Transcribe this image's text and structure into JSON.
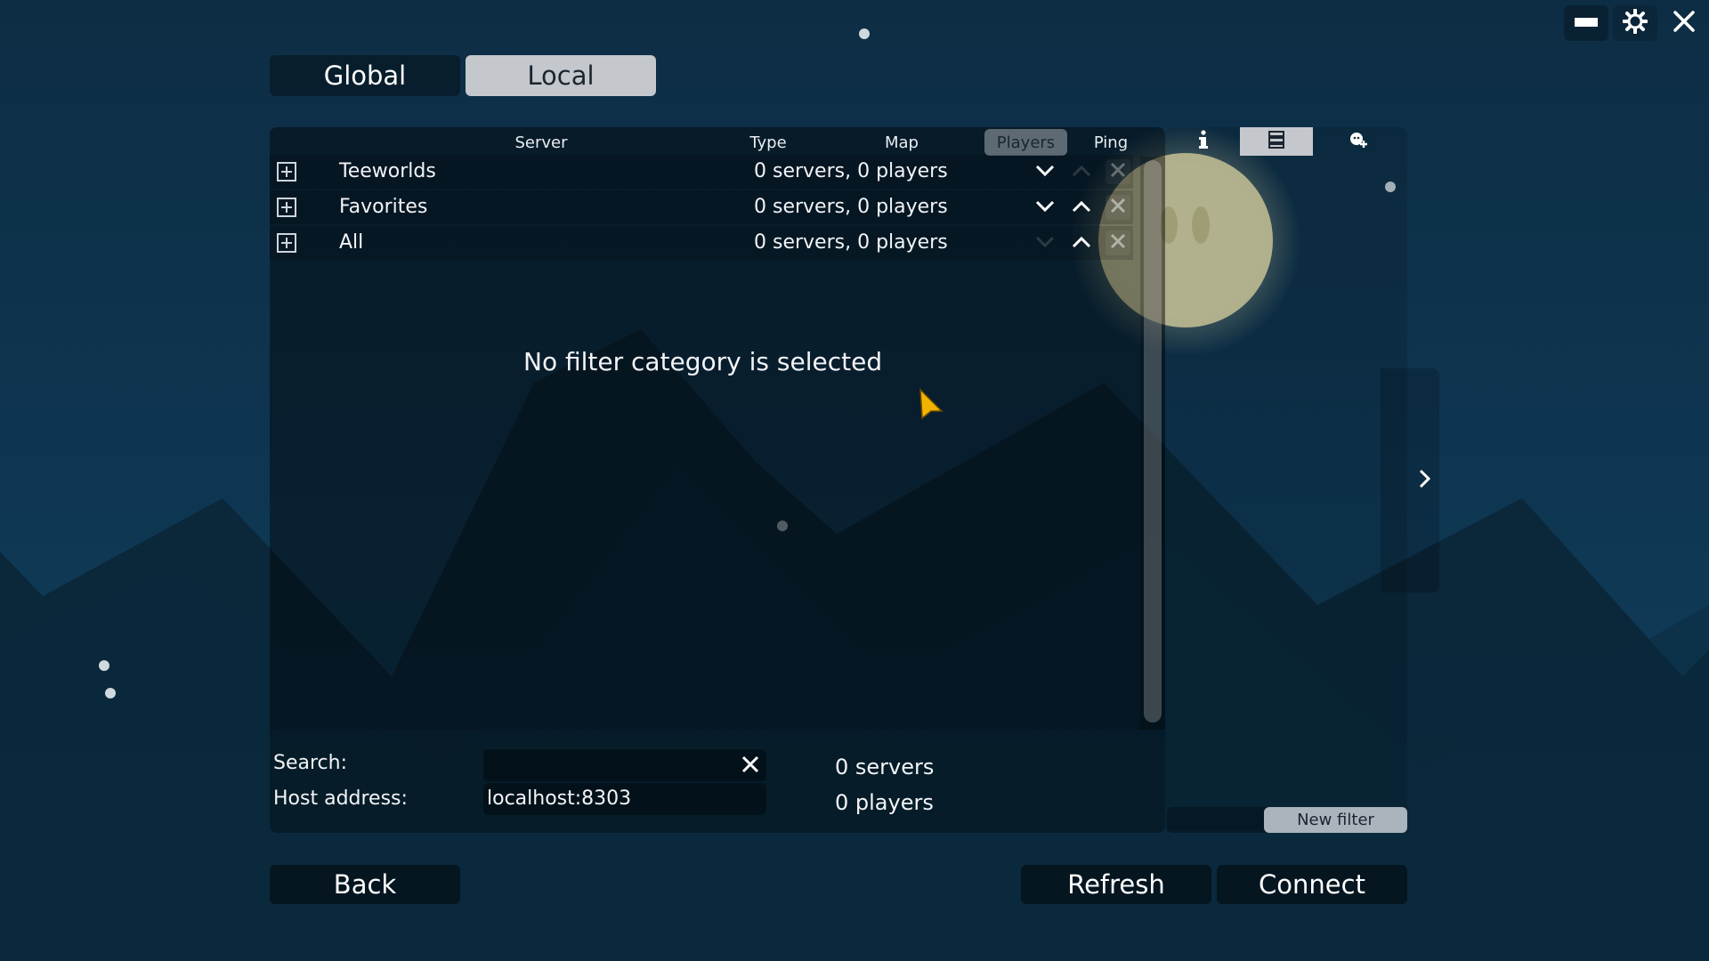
{
  "window_controls": {
    "minimize_icon": "minimize-icon",
    "settings_icon": "gear-icon",
    "close_icon": "close-icon"
  },
  "tabs": {
    "global": "Global",
    "local": "Local",
    "active": "Local"
  },
  "columns": [
    "Server",
    "Type",
    "Map",
    "Players",
    "Ping"
  ],
  "active_sort_column": "Players",
  "filters": [
    {
      "name": "Teeworlds",
      "info": "0 servers, 0 players"
    },
    {
      "name": "Favorites",
      "info": "0 servers, 0 players"
    },
    {
      "name": "All",
      "info": "0 servers, 0 players"
    }
  ],
  "empty_message": "No filter category is selected",
  "sidebar": {
    "tabs": [
      "info-icon",
      "server-list-icon",
      "add-friend-icon"
    ],
    "active_tab": "server-list-icon",
    "new_filter_label": "New filter"
  },
  "search": {
    "label": "Search:",
    "value": ""
  },
  "host": {
    "label": "Host address:",
    "value": "localhost:8303"
  },
  "summary": {
    "servers": "0 servers",
    "players": "0 players"
  },
  "buttons": {
    "back": "Back",
    "refresh": "Refresh",
    "connect": "Connect"
  },
  "colors": {
    "background": "#0e3550",
    "moon": "#d6d3a6",
    "active_tab": "#c4c8cc",
    "cursor": "#f0b400"
  }
}
